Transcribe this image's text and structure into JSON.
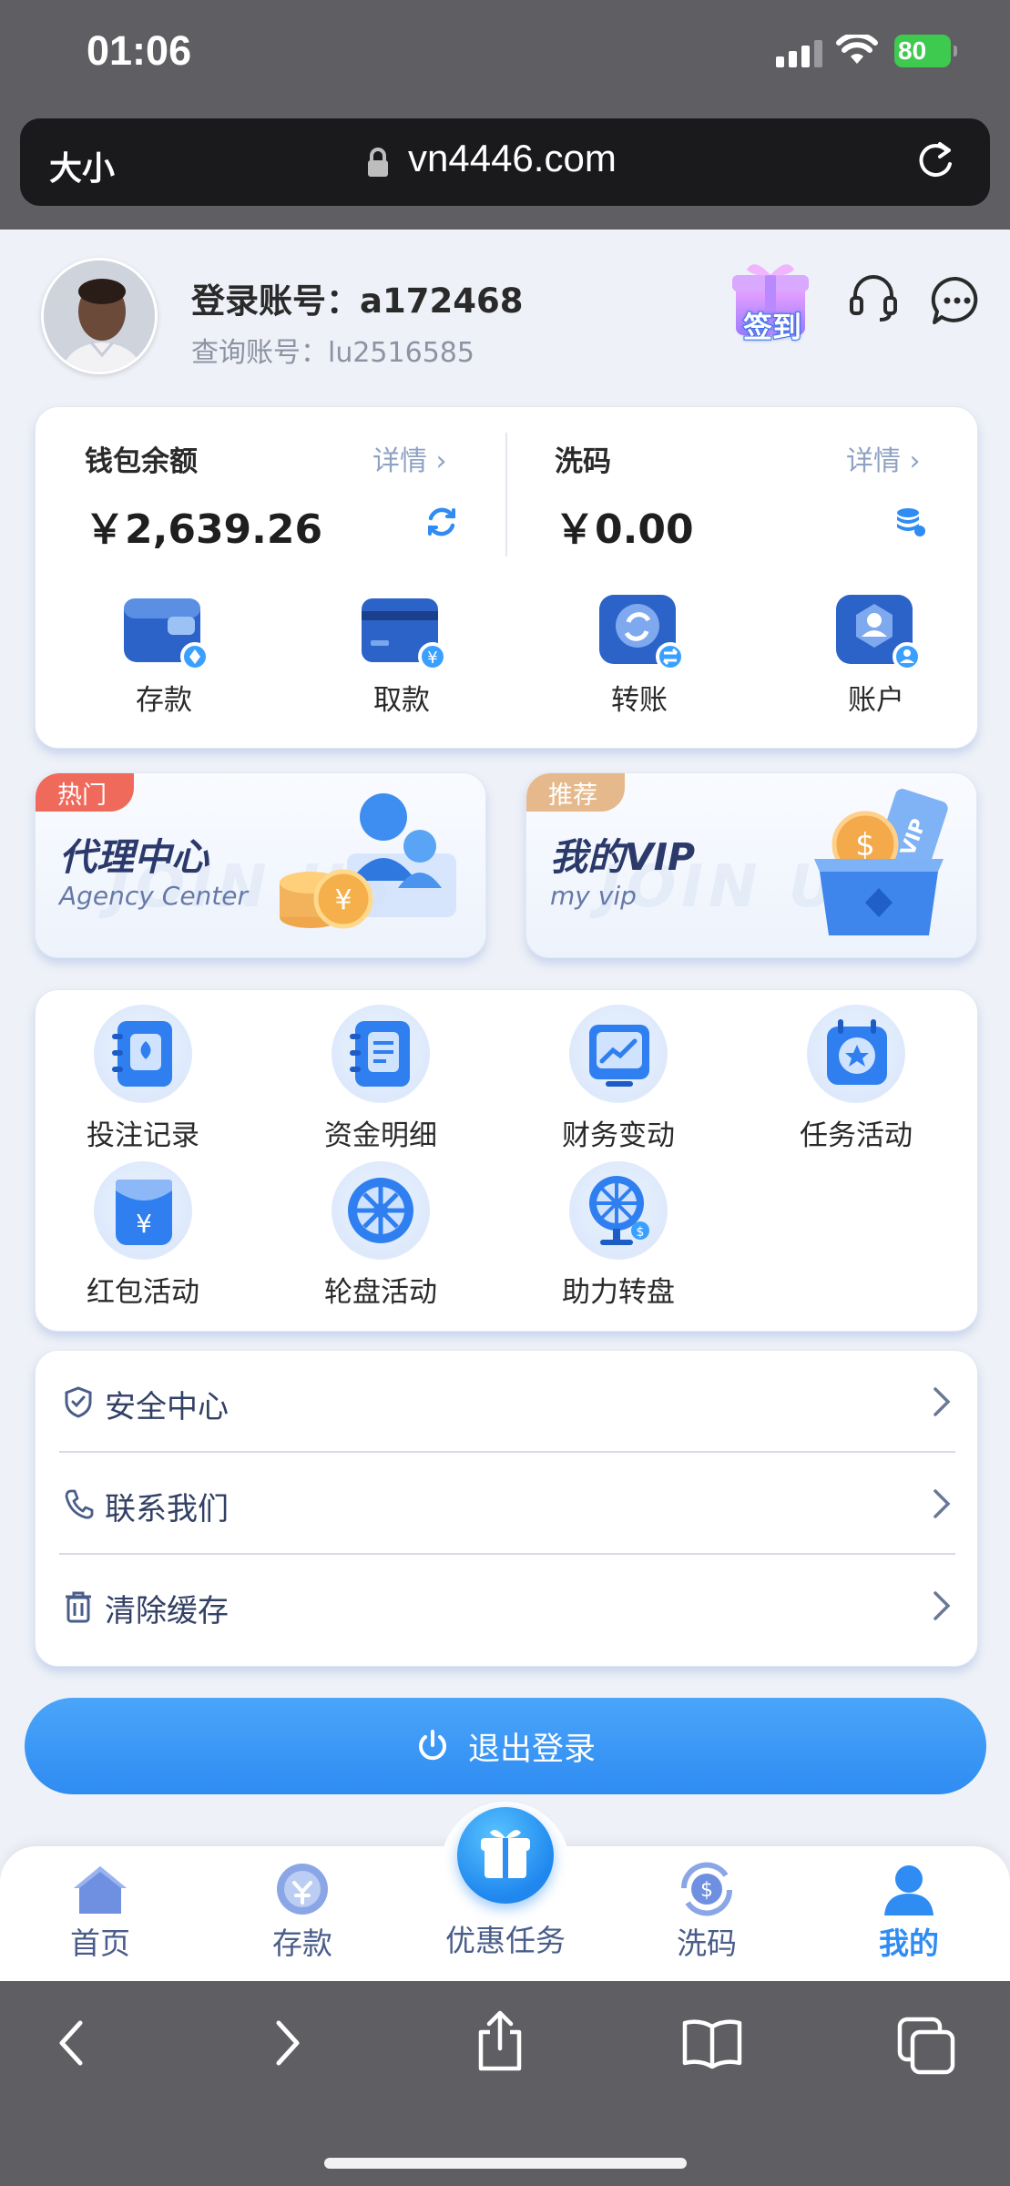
{
  "status_bar": {
    "time": "01:06",
    "battery": "80"
  },
  "browser": {
    "text_size": "大小",
    "url": "vn4446.com"
  },
  "header": {
    "account_label": "登录账号：a172468",
    "query_label": "查询账号：lu2516585",
    "checkin_label": "签到"
  },
  "wallet": {
    "balance_title": "钱包余额",
    "balance_detail": "详情 ›",
    "balance_amount": "￥2,639.26",
    "rebate_title": "洗码",
    "rebate_detail": "详情 ›",
    "rebate_amount": "￥0.00",
    "actions": [
      {
        "label": "存款",
        "icon": "deposit-wallet-icon"
      },
      {
        "label": "取款",
        "icon": "withdraw-card-icon"
      },
      {
        "label": "转账",
        "icon": "transfer-icon"
      },
      {
        "label": "账户",
        "icon": "account-icon"
      }
    ]
  },
  "promos": [
    {
      "badge": "热门",
      "title": "代理中心",
      "subtitle": "Agency Center",
      "watermark": "JOIN US",
      "badge_color": "#f06a5b"
    },
    {
      "badge": "推荐",
      "title": "我的VIP",
      "subtitle": "my vip",
      "watermark": "JOIN US",
      "badge_color": "#e6b98c"
    }
  ],
  "menu": [
    {
      "label": "投注记录",
      "icon": "bet-record-icon"
    },
    {
      "label": "资金明细",
      "icon": "fund-detail-icon"
    },
    {
      "label": "财务变动",
      "icon": "finance-change-icon"
    },
    {
      "label": "任务活动",
      "icon": "task-activity-icon"
    },
    {
      "label": "红包活动",
      "icon": "red-packet-icon"
    },
    {
      "label": "轮盘活动",
      "icon": "roulette-icon"
    },
    {
      "label": "助力转盘",
      "icon": "boost-wheel-icon"
    }
  ],
  "list": [
    {
      "label": "安全中心",
      "icon": "shield-icon"
    },
    {
      "label": "联系我们",
      "icon": "phone-icon"
    },
    {
      "label": "清除缓存",
      "icon": "trash-icon"
    }
  ],
  "logout_label": "退出登录",
  "tabs": [
    {
      "label": "首页",
      "icon": "home-icon"
    },
    {
      "label": "存款",
      "icon": "deposit-icon"
    },
    {
      "label": "优惠任务",
      "icon": "gift-icon"
    },
    {
      "label": "洗码",
      "icon": "rebate-icon"
    },
    {
      "label": "我的",
      "icon": "user-icon",
      "active": true
    }
  ],
  "colors": {
    "accent": "#2f8cf2",
    "hot_badge": "#f06a5b",
    "recommend_badge": "#e6b98c"
  }
}
